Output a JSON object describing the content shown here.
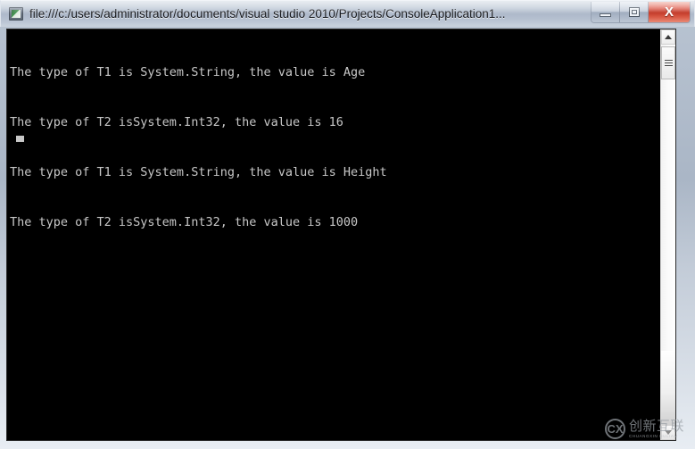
{
  "window": {
    "title": "file:///c:/users/administrator/documents/visual studio 2010/Projects/ConsoleApplication1...",
    "icon": "console-app-icon",
    "controls": {
      "minimize_label": "–",
      "maximize_label": "□",
      "close_label": "X",
      "close_color": "#c23a29"
    }
  },
  "console": {
    "background_color": "#000000",
    "text_color": "#c8c8c8",
    "lines": [
      "The type of T1 is System.String, the value is Age",
      "The type of T2 isSystem.Int32, the value is 16",
      "The type of T1 is System.String, the value is Height",
      "The type of T2 isSystem.Int32, the value is 1000"
    ],
    "cursor_visible": true
  },
  "scrollbar": {
    "up_arrow": "scroll-up-arrow",
    "down_arrow": "scroll-down-arrow",
    "thumb": "scroll-thumb"
  },
  "watermark": {
    "mark": "CX",
    "name": "创新互联",
    "subtitle": "CHUANGXIN HULIAN"
  }
}
